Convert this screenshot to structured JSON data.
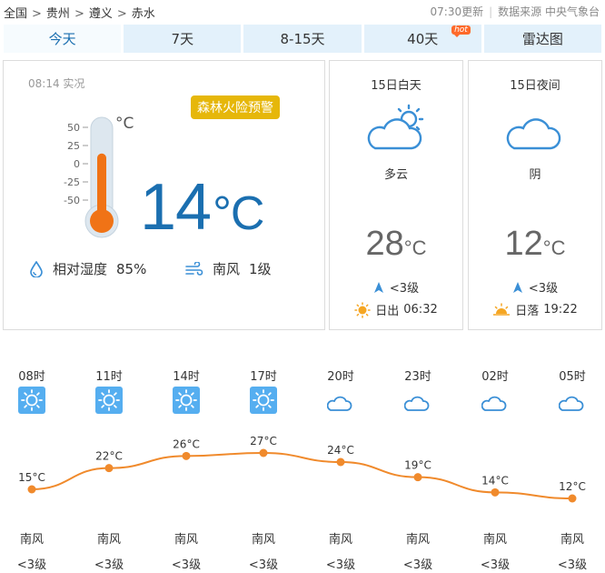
{
  "breadcrumb": {
    "items": [
      "全国",
      "贵州",
      "遵义",
      "赤水"
    ],
    "separator": ">"
  },
  "meta": {
    "update_time": "07:30更新",
    "source": "数据来源 中央气象台"
  },
  "tabs": [
    {
      "label": "今天",
      "active": true
    },
    {
      "label": "7天",
      "active": false
    },
    {
      "label": "8-15天",
      "active": false
    },
    {
      "label": "40天",
      "active": false,
      "badge": "hot"
    },
    {
      "label": "雷达图",
      "active": false
    }
  ],
  "current": {
    "observed": "08:14 实况",
    "alert": "森林火险预警",
    "temp": "14",
    "unit": "°C",
    "thermo_unit": "°C",
    "thermo_scale": [
      "50",
      "25",
      "0",
      "-25",
      "-50"
    ],
    "thermo_level": 14,
    "humidity_label": "相对湿度",
    "humidity_value": "85%",
    "wind_dir": "南风",
    "wind_level": "1级"
  },
  "day": {
    "title": "15日白天",
    "condition": "多云",
    "icon": "partly-cloudy-day-icon",
    "temp": "28",
    "unit": "°C",
    "wind": "<3级",
    "sun_label": "日出",
    "sun_time": "06:32"
  },
  "night": {
    "title": "15日夜间",
    "condition": "阴",
    "icon": "cloudy-night-icon",
    "temp": "12",
    "unit": "°C",
    "wind": "<3级",
    "sun_label": "日落",
    "sun_time": "19:22"
  },
  "hourly": [
    {
      "time": "08时",
      "icon": "sunny-icon",
      "temp": "15°C",
      "wind": "南风",
      "level": "<3级"
    },
    {
      "time": "11时",
      "icon": "sunny-icon",
      "temp": "22°C",
      "wind": "南风",
      "level": "<3级"
    },
    {
      "time": "14时",
      "icon": "sunny-icon",
      "temp": "26°C",
      "wind": "南风",
      "level": "<3级"
    },
    {
      "time": "17时",
      "icon": "sunny-icon",
      "temp": "27°C",
      "wind": "南风",
      "level": "<3级"
    },
    {
      "time": "20时",
      "icon": "cloudy-night-icon",
      "temp": "24°C",
      "wind": "南风",
      "level": "<3级"
    },
    {
      "time": "23时",
      "icon": "cloudy-night-icon",
      "temp": "19°C",
      "wind": "南风",
      "level": "<3级"
    },
    {
      "time": "02时",
      "icon": "cloudy-night-icon",
      "temp": "14°C",
      "wind": "南风",
      "level": "<3级"
    },
    {
      "time": "05时",
      "icon": "cloudy-night-icon",
      "temp": "12°C",
      "wind": "南风",
      "level": "<3级"
    }
  ],
  "chart_data": {
    "type": "line",
    "categories": [
      "08时",
      "11时",
      "14时",
      "17时",
      "20时",
      "23时",
      "02时",
      "05时"
    ],
    "series": [
      {
        "values": [
          15,
          22,
          26,
          27,
          24,
          19,
          14,
          12
        ]
      }
    ],
    "ylabel": "",
    "line_color": "#f08a2c"
  },
  "colors": {
    "accent": "#1b6fb0",
    "tab_bg": "#e3f1fb",
    "alert": "#e6b70a",
    "line": "#f08a2c",
    "icon_blue": "#3a8fd6",
    "sun": "#f5a623"
  }
}
